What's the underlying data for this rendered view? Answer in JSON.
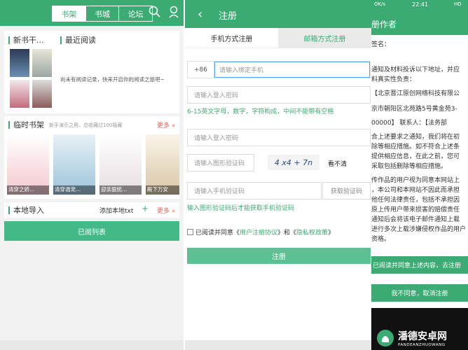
{
  "shelf": {
    "tabs": [
      "书架",
      "书城",
      "论坛"
    ],
    "new_books": "新书干...",
    "recent": "最近阅读",
    "no_record": "尚未有阅读记录，快来开启你的阅读之旅吧~",
    "temp_shelf": "临时书架",
    "temp_note": "新手演示之用，总收藏过100隐藏",
    "more": "更多",
    "book_titles": [
      "清穿之娇...",
      "清穿温宠...",
      "迎亲狠统...",
      "殿下万安"
    ],
    "local_import": "本地导入",
    "add_txt": "添加本地txt",
    "plus": "+",
    "read_list": "已阅列表"
  },
  "register": {
    "title": "注册",
    "tab_phone": "手机方式注册",
    "tab_email": "邮箱方式注册",
    "country_code": "+86",
    "phone_placeholder": "请输入绑定手机",
    "pwd_placeholder": "请输入登入密码",
    "pwd_hint": "6-15英文字母，数字，字符构成，中间不能带有空格",
    "confirm_placeholder": "请输入登入密码",
    "captcha_placeholder": "请输入图形验证码",
    "captcha_image": "4 x4 + 7n",
    "captcha_refresh": "看不清",
    "sms_placeholder": "请输入手机验证码",
    "get_code": "获取验证码",
    "sms_hint": "输入图形验证码后才能获取手机验证码",
    "agree_prefix": "已阅读并同意《",
    "agree_link1": "用户注册协议",
    "agree_mid": "》和《",
    "agree_link2": "隐私权政策",
    "agree_suffix": "》",
    "submit": "注册"
  },
  "author": {
    "status_time": "22:41",
    "status_left": "OK/s",
    "status_right": "HD",
    "title": "册作者",
    "lines": [
      "签名：",
      "通知及材料投诉以下地址，并应",
      "料真实性负责：",
      "【北京晋江原创网络科技有限公",
      "京市朝阳区北苑路5号黄金苑3-",
      "00000】  联系人：【法务部",
      "合上述要求之通知，我们将在初",
      "除等相应措施。如不符合上述条",
      "提供相应信息，在此之前，您可",
      "采取包括删除等相应措施。",
      "传作品的用户视为同意本网站上",
      "，本公司和本网站不因此而承担",
      "他任何法律责任，包括不承担因",
      "原上传用户带来损害的赔偿责任",
      "通知后会将该电子邮件通知上载",
      "进行多次上载涉嫌侵权作品的用户",
      "资格。"
    ],
    "agree_btn": "已阅读并同意上述内容，去注册",
    "disagree_btn": "我不同意，取消注册"
  },
  "watermark": {
    "name": "潘德安卓网",
    "sub": "PANDEANZHUOWANG"
  },
  "colors": {
    "accent": "#3cab73",
    "link": "#3cab73"
  }
}
